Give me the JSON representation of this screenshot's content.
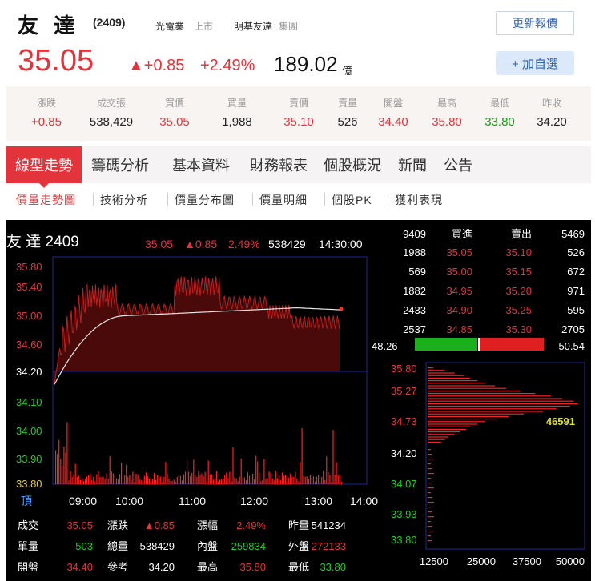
{
  "header": {
    "name": "友 達",
    "code": "(2409)",
    "industry": "光電業",
    "market": "上市",
    "group_a": "明基友達",
    "group_b": "集團",
    "refresh_label": "更新報價",
    "add_label": "+ 加自選",
    "price": "35.05",
    "change": "▲+0.85",
    "change_pct": "+2.49%",
    "amount": "189.02",
    "amount_unit": "億"
  },
  "quote": [
    {
      "label": "漲跌",
      "value": "+0.85",
      "color": "#e3343c"
    },
    {
      "label": "成交張",
      "value": "538,429",
      "color": "#222222"
    },
    {
      "label": "買價",
      "value": "35.05",
      "color": "#e3343c"
    },
    {
      "label": "買量",
      "value": "1,988",
      "color": "#222222"
    },
    {
      "label": "賣價",
      "value": "35.10",
      "color": "#e3343c"
    },
    {
      "label": "賣量",
      "value": "526",
      "color": "#222222"
    },
    {
      "label": "開盤",
      "value": "34.40",
      "color": "#e3343c"
    },
    {
      "label": "最高",
      "value": "35.80",
      "color": "#e3343c"
    },
    {
      "label": "最低",
      "value": "33.80",
      "color": "#1a9a1a"
    },
    {
      "label": "昨收",
      "value": "34.20",
      "color": "#222222"
    }
  ],
  "tabs": [
    "線型走勢",
    "籌碼分析",
    "基本資料",
    "財務報表",
    "個股概況",
    "新聞",
    "公告"
  ],
  "subtabs": [
    "價量走勢圖",
    "技術分析",
    "價量分布圖",
    "價量明細",
    "個股PK",
    "獲利表現"
  ],
  "chart": {
    "title": "友  達 2409",
    "info": [
      "35.05",
      "▲0.85",
      "2.49%",
      "538429",
      "14:30:00"
    ],
    "y_labels": [
      "35.80",
      "35.40",
      "35.00",
      "34.60",
      "34.20",
      "34.10",
      "34.00",
      "33.90",
      "33.80"
    ],
    "x_labels": [
      "頂",
      "09:00",
      "10:00",
      "11:00",
      "12:00",
      "13:00",
      "14:00"
    ],
    "stats": [
      [
        [
          "成交",
          "35.05"
        ],
        [
          "漲跌",
          "▲0.85"
        ],
        [
          "漲幅",
          "2.49%"
        ],
        [
          "昨量",
          "541234"
        ]
      ],
      [
        [
          "單量",
          "503"
        ],
        [
          "總量",
          "538429"
        ],
        [
          "內盤",
          "259834"
        ],
        [
          "外盤",
          "272133"
        ]
      ],
      [
        [
          "開盤",
          "34.40"
        ],
        [
          "參考",
          "34.20"
        ],
        [
          "最高",
          "35.80"
        ],
        [
          "最低",
          "33.80"
        ]
      ]
    ],
    "order_book": {
      "head": [
        "9409",
        "買進",
        "賣出",
        "5469"
      ],
      "rows": [
        [
          "1988",
          "35.05",
          "35.10",
          "526"
        ],
        [
          "569",
          "35.00",
          "35.15",
          "672"
        ],
        [
          "1882",
          "34.95",
          "35.20",
          "971"
        ],
        [
          "2433",
          "34.90",
          "35.25",
          "595"
        ],
        [
          "2537",
          "34.85",
          "35.30",
          "2705"
        ]
      ],
      "ratio_left": "48.26",
      "ratio_right": "50.54"
    },
    "dist": {
      "y_labels": [
        "35.80",
        "35.27",
        "34.73",
        "34.20",
        "34.07",
        "33.93",
        "33.80"
      ],
      "x_labels": [
        "12500",
        "25000",
        "37500",
        "50000"
      ],
      "peak": "46591"
    }
  },
  "chart_data": {
    "type": "line",
    "title": "友  達 2409",
    "xlabel": "",
    "ylabel": "",
    "ylim": [
      33.8,
      35.8
    ],
    "x": [
      "09:00",
      "09:30",
      "10:00",
      "10:30",
      "11:00",
      "11:30",
      "12:00",
      "12:30",
      "13:00",
      "13:30",
      "13:45"
    ],
    "series": [
      {
        "values": [
          34.0,
          35.1,
          35.6,
          35.3,
          35.1,
          35.5,
          35.7,
          35.3,
          35.2,
          35.0,
          35.05
        ]
      },
      {
        "values": [
          34.0,
          34.8,
          35.0,
          35.05,
          35.05,
          35.1,
          35.15,
          35.2,
          35.2,
          35.15,
          35.15
        ]
      }
    ]
  }
}
